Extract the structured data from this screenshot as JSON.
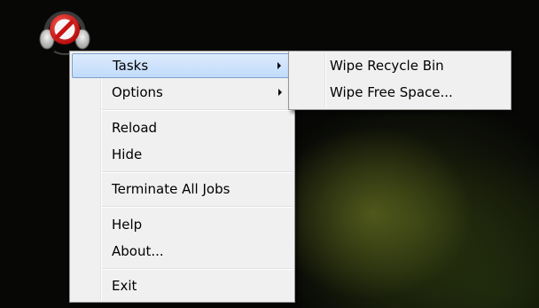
{
  "tray_icon": {
    "icon": "no-entry-headset-icon"
  },
  "context_menu": {
    "items": [
      {
        "label": "Tasks",
        "has_submenu": true,
        "highlighted": true
      },
      {
        "label": "Options",
        "has_submenu": true
      },
      {
        "label": "Reload"
      },
      {
        "label": "Hide"
      },
      {
        "label": "Terminate All Jobs"
      },
      {
        "label": "Help"
      },
      {
        "label": "About..."
      },
      {
        "label": "Exit"
      }
    ]
  },
  "submenu_tasks": {
    "items": [
      {
        "label": "Wipe Recycle Bin"
      },
      {
        "label": "Wipe Free Space..."
      }
    ]
  },
  "colors": {
    "menu_background": "#f0f0f0",
    "highlight_top": "#dcebfc",
    "highlight_bottom": "#c1dbfc",
    "highlight_border": "#7da2ce"
  }
}
